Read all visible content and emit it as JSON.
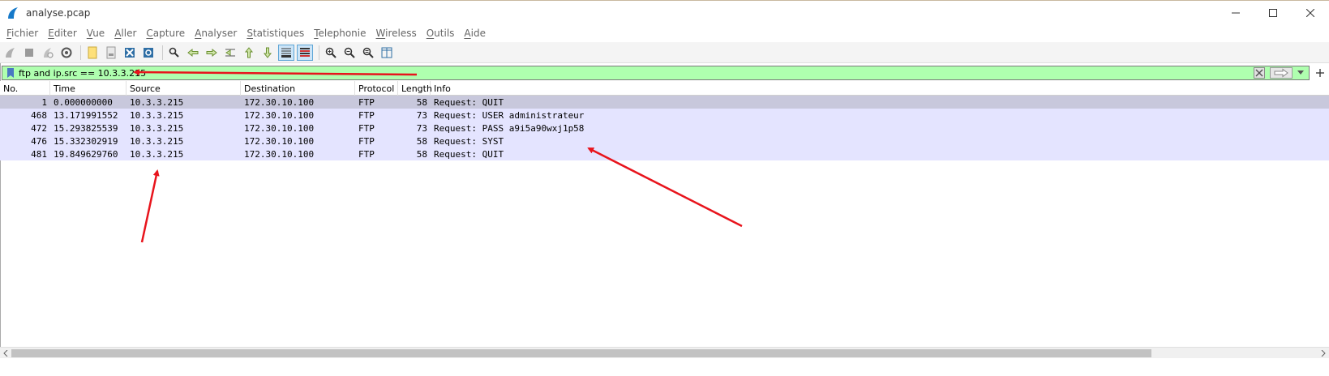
{
  "window": {
    "title": "analyse.pcap",
    "controls": [
      "minimize-icon",
      "maximize-icon",
      "close-icon"
    ]
  },
  "menu": [
    "Fichier",
    "Editer",
    "Vue",
    "Aller",
    "Capture",
    "Analyser",
    "Statistiques",
    "Telephonie",
    "Wireless",
    "Outils",
    "Aide"
  ],
  "filter": {
    "value": "ftp and ip.src == 10.3.3.215",
    "bg_color": "#afffaf"
  },
  "columns": [
    "No.",
    "Time",
    "Source",
    "Destination",
    "Protocol",
    "Length",
    "Info"
  ],
  "packets": [
    {
      "no": "1",
      "time": "0.000000000",
      "src": "10.3.3.215",
      "dst": "172.30.10.100",
      "proto": "FTP",
      "len": "58",
      "info": "Request: QUIT"
    },
    {
      "no": "468",
      "time": "13.171991552",
      "src": "10.3.3.215",
      "dst": "172.30.10.100",
      "proto": "FTP",
      "len": "73",
      "info": "Request: USER administrateur"
    },
    {
      "no": "472",
      "time": "15.293825539",
      "src": "10.3.3.215",
      "dst": "172.30.10.100",
      "proto": "FTP",
      "len": "73",
      "info": "Request: PASS a9i5a90wxj1p58"
    },
    {
      "no": "476",
      "time": "15.332302919",
      "src": "10.3.3.215",
      "dst": "172.30.10.100",
      "proto": "FTP",
      "len": "58",
      "info": "Request: SYST"
    },
    {
      "no": "481",
      "time": "19.849629760",
      "src": "10.3.3.215",
      "dst": "172.30.10.100",
      "proto": "FTP",
      "len": "58",
      "info": "Request: QUIT"
    }
  ],
  "colors": {
    "row": "#e4e4ff",
    "row_selected": "#c8c8dc",
    "annotation_arrow": "#e8141c"
  }
}
